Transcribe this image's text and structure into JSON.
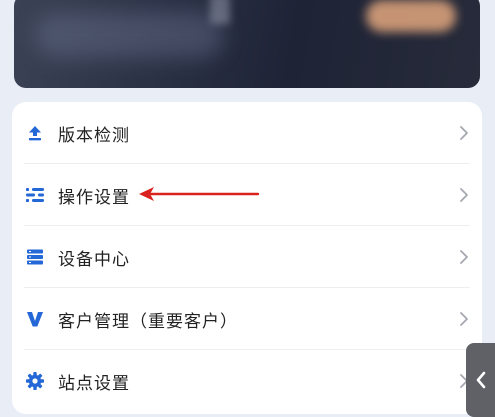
{
  "colors": {
    "accent": "#2467d6",
    "annotation_arrow": "#d9221e",
    "chevron": "#a5a8ae"
  },
  "menu": {
    "items": [
      {
        "label": "版本检测",
        "icon": "upload-icon"
      },
      {
        "label": "操作设置",
        "icon": "sliders-icon"
      },
      {
        "label": "设备中心",
        "icon": "server-icon"
      },
      {
        "label": "客户管理（重要客户）",
        "icon": "v-letter-icon"
      },
      {
        "label": "站点设置",
        "icon": "gear-icon"
      }
    ]
  },
  "annotation": {
    "points_to": "操作设置"
  },
  "side_tab": {
    "icon": "chevron-left-icon"
  }
}
